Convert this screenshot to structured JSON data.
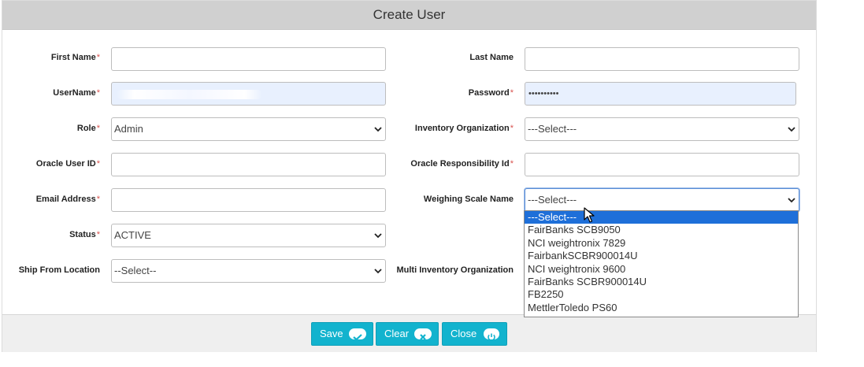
{
  "modal": {
    "title": "Create User"
  },
  "form": {
    "first_name": {
      "label": "First Name",
      "required": "*",
      "value": ""
    },
    "last_name": {
      "label": "Last Name",
      "value": ""
    },
    "username": {
      "label": "UserName",
      "required": "*"
    },
    "password": {
      "label": "Password",
      "required": "*",
      "value": "••••••••••"
    },
    "role": {
      "label": "Role",
      "required": "*",
      "value": "Admin"
    },
    "inventory_org": {
      "label": "Inventory Organization",
      "required": "*",
      "value": "---Select---"
    },
    "oracle_user_id": {
      "label": "Oracle User ID",
      "required": "*",
      "value": ""
    },
    "oracle_resp_id": {
      "label": "Oracle Responsibility Id",
      "required": "*",
      "value": ""
    },
    "email": {
      "label": "Email Address",
      "required": "*",
      "value": ""
    },
    "weighing_scale": {
      "label": "Weighing Scale Name",
      "value": "---Select---",
      "options": [
        "---Select---",
        "FairBanks SCB9050",
        "NCI weightronix 7829",
        "FairbankSCBR900014U",
        "NCI weightronix 9600",
        "FairBanks SCBR900014U",
        "FB2250",
        "MettlerToledo PS60"
      ]
    },
    "status": {
      "label": "Status",
      "required": "*",
      "value": "ACTIVE"
    },
    "ship_from": {
      "label": "Ship From Location",
      "value": "--Select--"
    },
    "multi_inventory": {
      "label": "Multi Inventory Organization"
    }
  },
  "buttons": {
    "save": "Save",
    "clear": "Clear",
    "close": "Close"
  },
  "colors": {
    "accent": "#12b3ce",
    "required": "#d9534f",
    "selected_option": "#1e6fd9"
  },
  "icons": {
    "save": "check-icon",
    "clear": "x-circle-icon",
    "close": "power-icon",
    "dropdown": "chevron-down-icon"
  }
}
